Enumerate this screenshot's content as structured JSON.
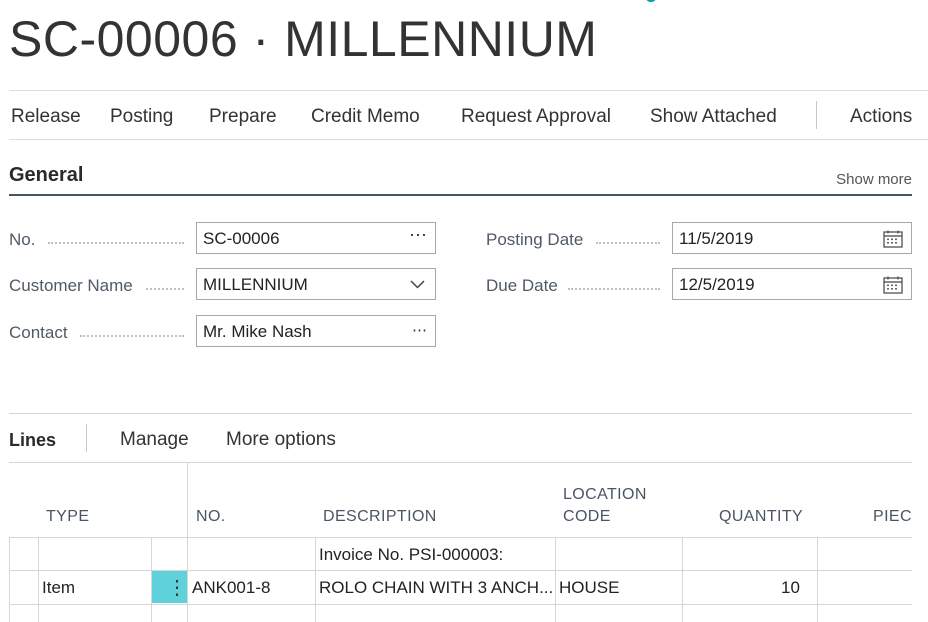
{
  "header": {
    "title": "SC-00006 · MILLENNIUM"
  },
  "actionbar": {
    "items": [
      "Release",
      "Posting",
      "Prepare",
      "Credit Memo",
      "Request Approval",
      "Show Attached"
    ],
    "actions_label": "Actions"
  },
  "general": {
    "title": "General",
    "show_more": "Show more",
    "no_label": "No.",
    "no_value": "SC-00006",
    "customer_label": "Customer Name",
    "customer_value": "MILLENNIUM",
    "contact_label": "Contact",
    "contact_value": "Mr. Mike Nash",
    "posting_date_label": "Posting Date",
    "posting_date_value": "11/5/2019",
    "due_date_label": "Due Date",
    "due_date_value": "12/5/2019"
  },
  "lines": {
    "title": "Lines",
    "manage": "Manage",
    "more_options": "More options",
    "columns": {
      "type": "TYPE",
      "no": "NO.",
      "description": "DESCRIPTION",
      "location_1": "LOCATION",
      "location_2": "CODE",
      "quantity": "QUANTITY",
      "pieces": "PIEC"
    },
    "rows": [
      {
        "type": "",
        "no": "",
        "description": "Invoice No. PSI-000003:",
        "location": "",
        "quantity": ""
      },
      {
        "type": "Item",
        "no": "ANK001-8",
        "description": "ROLO CHAIN WITH 3 ANCH...",
        "location": "HOUSE",
        "quantity": "10"
      }
    ]
  },
  "icons": {
    "ellipsis": "⋯",
    "kebab": "⋮"
  }
}
